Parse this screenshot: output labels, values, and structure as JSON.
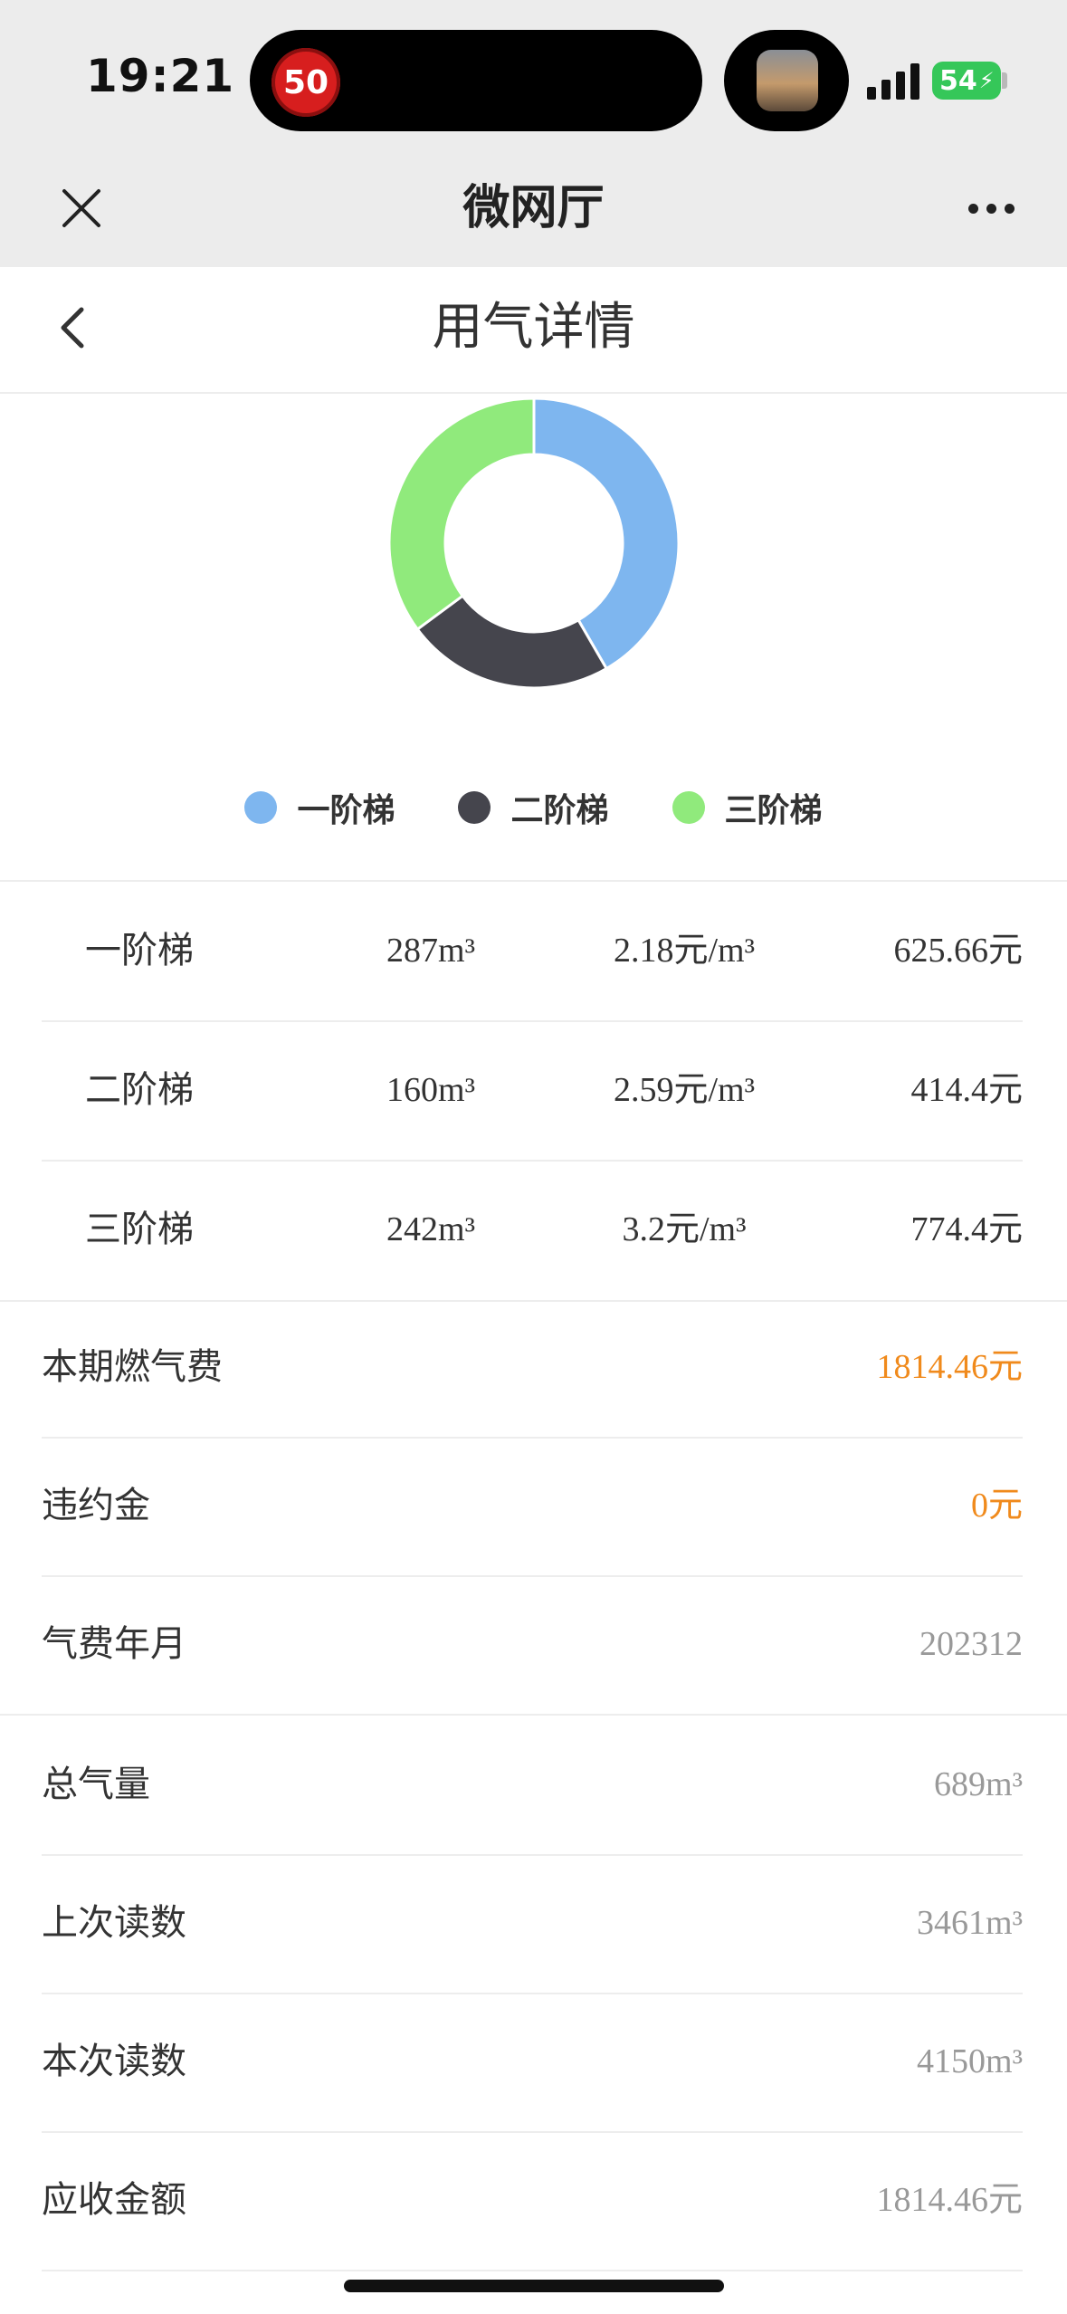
{
  "status_bar": {
    "time": "19:21",
    "speed_badge": "50",
    "battery": "54"
  },
  "nav": {
    "title": "微网厅"
  },
  "page": {
    "title": "用气详情"
  },
  "colors": {
    "tier1": "#7eb6ef",
    "tier2": "#45454d",
    "tier3": "#90ea7c",
    "orange": "#f08a1c"
  },
  "chart_data": {
    "type": "pie",
    "donut": true,
    "categories": [
      "一阶梯",
      "二阶梯",
      "三阶梯"
    ],
    "values": [
      287,
      160,
      242
    ],
    "colors": [
      "#7eb6ef",
      "#45454d",
      "#90ea7c"
    ],
    "legend_position": "bottom"
  },
  "legend": [
    {
      "label": "一阶梯"
    },
    {
      "label": "二阶梯"
    },
    {
      "label": "三阶梯"
    }
  ],
  "tiers": [
    {
      "name": "一阶梯",
      "volume": "287m³",
      "price": "2.18元/m³",
      "amount": "625.66元"
    },
    {
      "name": "二阶梯",
      "volume": "160m³",
      "price": "2.59元/m³",
      "amount": "414.4元"
    },
    {
      "name": "三阶梯",
      "volume": "242m³",
      "price": "3.2元/m³",
      "amount": "774.4元"
    }
  ],
  "details": [
    {
      "label": "本期燃气费",
      "value": "1814.46元"
    },
    {
      "label": "违约金",
      "value": "0元"
    },
    {
      "label": "气费年月",
      "value": "202312"
    },
    {
      "label": "总气量",
      "value": "689m³"
    },
    {
      "label": "上次读数",
      "value": "3461m³"
    },
    {
      "label": "本次读数",
      "value": "4150m³"
    },
    {
      "label": "应收金额",
      "value": "1814.46元"
    }
  ]
}
